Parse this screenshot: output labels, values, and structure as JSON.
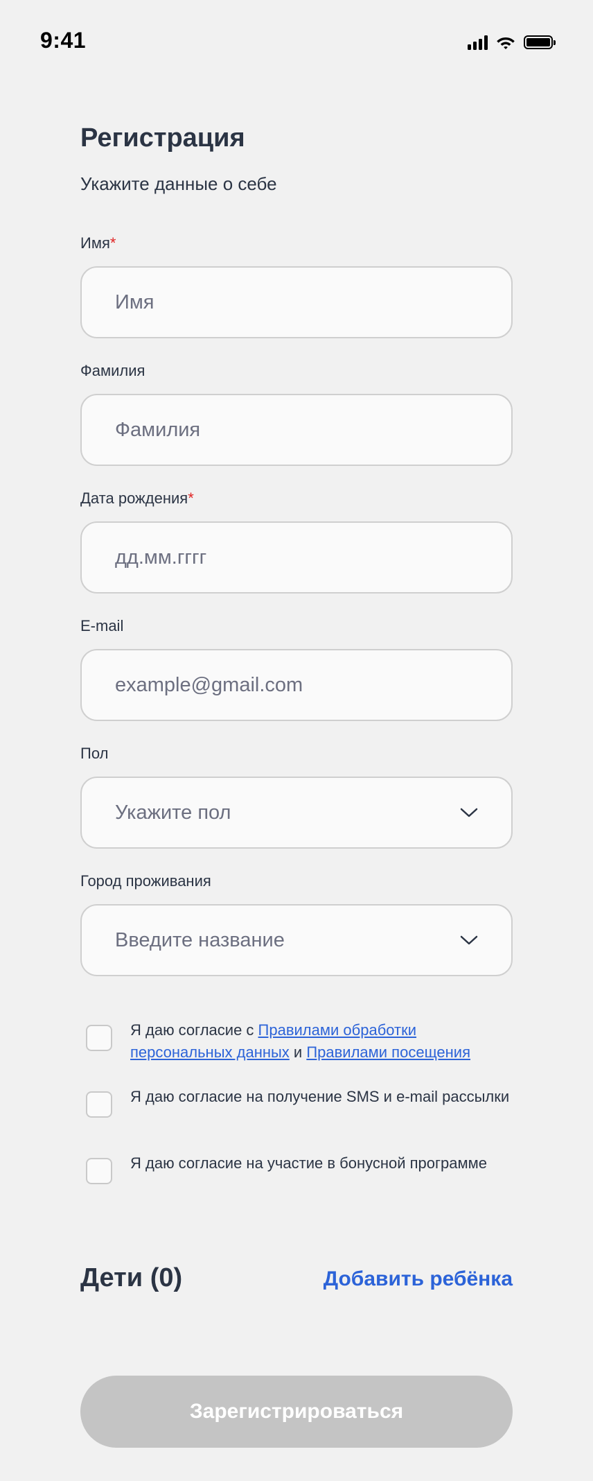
{
  "status_bar": {
    "time": "9:41"
  },
  "header": {
    "title": "Регистрация",
    "subtitle": "Укажите данные о себе"
  },
  "form": {
    "first_name": {
      "label": "Имя",
      "required_mark": "*",
      "placeholder": "Имя",
      "value": ""
    },
    "last_name": {
      "label": "Фамилия",
      "placeholder": "Фамилия",
      "value": ""
    },
    "birth_date": {
      "label": "Дата рождения",
      "required_mark": "*",
      "placeholder": "дд.мм.гггг",
      "value": ""
    },
    "email": {
      "label": "E-mail",
      "placeholder": "example@gmail.com",
      "value": ""
    },
    "gender": {
      "label": "Пол",
      "placeholder": "Укажите пол",
      "icon": "chevron-down-icon"
    },
    "city": {
      "label": "Город проживания",
      "placeholder": "Введите название",
      "icon": "chevron-down-icon"
    }
  },
  "consents": {
    "personal_data": {
      "checked": false,
      "text_prefix": "Я даю согласие с ",
      "link1": "Правилами обработки персональных данных",
      "text_middle": " и ",
      "link2": "Правилами посещения"
    },
    "sms_email": {
      "checked": false,
      "text": "Я даю согласие на получение SMS и e-mail рассылки"
    },
    "bonus": {
      "checked": false,
      "text": "Я даю согласие на участие в бонусной программе"
    }
  },
  "children": {
    "title": "Дети (0)",
    "add_label": "Добавить ребёнка"
  },
  "submit": {
    "label": "Зарегистрироваться",
    "enabled": false
  },
  "colors": {
    "background": "#f1f1f1",
    "text": "#2b3444",
    "accent": "#2c63d8",
    "required": "#e02424",
    "disabled_button": "#c4c4c4"
  }
}
